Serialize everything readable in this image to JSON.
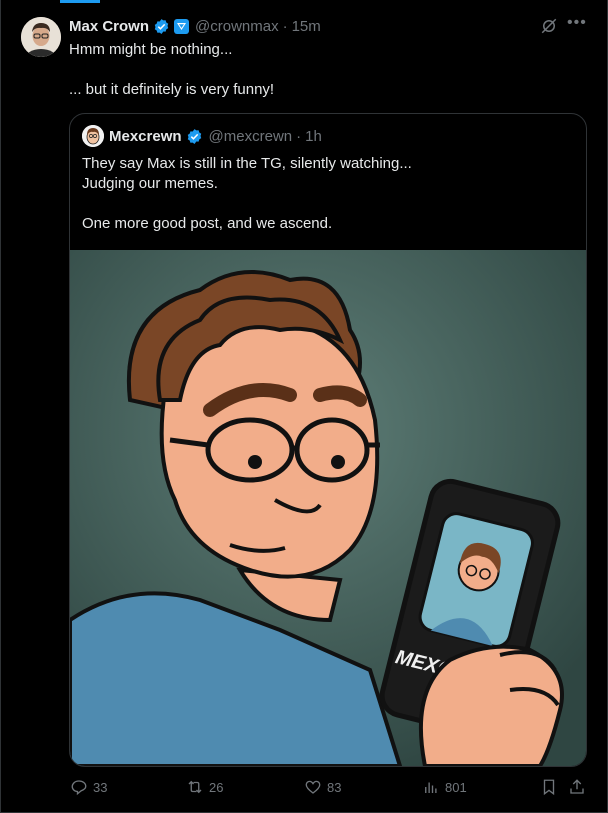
{
  "tweet": {
    "author_name": "Max Crown",
    "handle": "@crownmax",
    "separator": "·",
    "time": "15m",
    "text": "Hmm might be nothing...\n\n... but it definitely is very funny!"
  },
  "quoted": {
    "author_name": "Mexcrewn",
    "handle": "@mexcrewn",
    "separator": "·",
    "time": "1h",
    "text": "They say Max is still in the TG, silently watching...\nJudging our memes.\n\nOne more good post, and we ascend.",
    "image_phone_label": "MEXCREWN"
  },
  "actions": {
    "replies": "33",
    "reposts": "26",
    "likes": "83",
    "views": "801"
  },
  "colors": {
    "accent": "#1d9bf0",
    "muted": "#71767b",
    "text": "#e7e9ea",
    "background": "#000000"
  },
  "icons": [
    "verified-badge-icon",
    "affiliate-badge-icon",
    "grok-icon",
    "more-icon",
    "reply-icon",
    "repost-icon",
    "like-icon",
    "views-icon",
    "bookmark-icon",
    "share-icon"
  ]
}
